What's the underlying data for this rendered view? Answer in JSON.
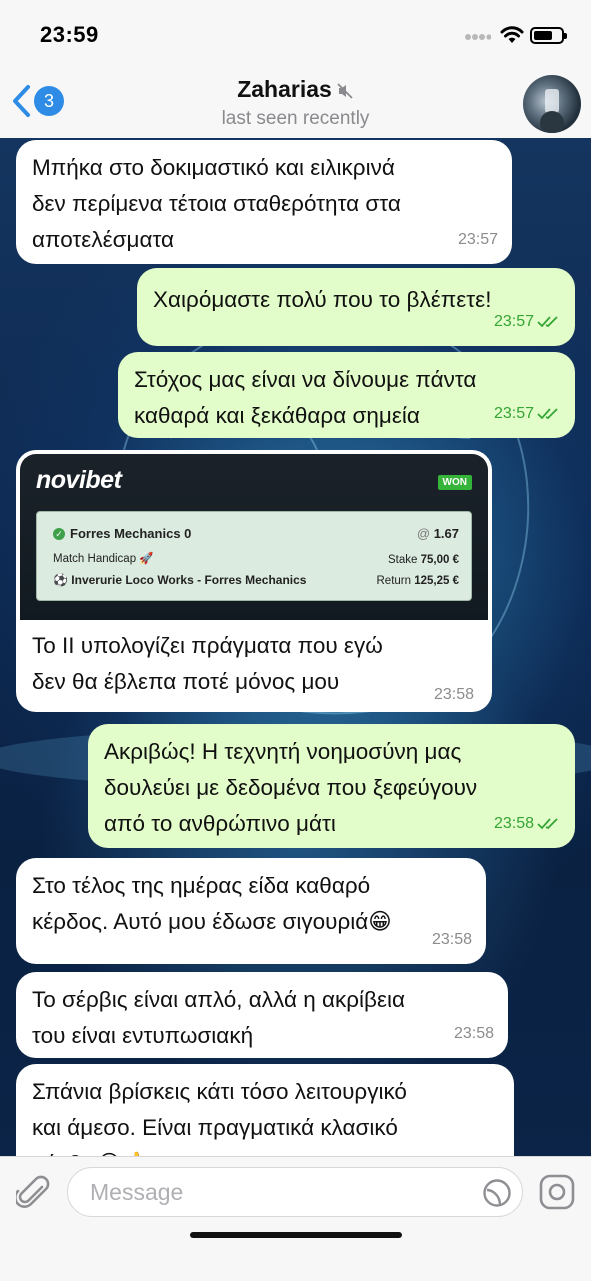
{
  "status": {
    "time": "23:59",
    "battery_level": 0.7
  },
  "header": {
    "back_count": "3",
    "contact_name": "Zaharias",
    "last_seen": "last seen recently"
  },
  "messages": [
    {
      "dir": "in",
      "text": "Μπήκα στο δοκιμαστικό και ειλικρινά\nδεν περίμενα τέτοια σταθερότητα στα\nαποτελέσματα",
      "time": "23:57"
    },
    {
      "dir": "out",
      "text": "Χαιρόμαστε πολύ που το βλέπετε!",
      "time": "23:57"
    },
    {
      "dir": "out",
      "text": "Στόχος μας είναι να δίνουμε πάντα\nκαθαρά και ξεκάθαρα σημεία",
      "time": "23:57"
    },
    {
      "dir": "in",
      "text": "Το ΙΙ υπολογίζει πράγματα που εγώ\nδεν θα έβλεπα ποτέ μόνος μου",
      "time": "23:58"
    },
    {
      "dir": "out",
      "text": "Ακριβώς! Η τεχνητή νοημοσύνη μας\nδουλεύει με δεδομένα που ξεφεύγουν\nαπό το ανθρώπινο μάτι",
      "time": "23:58"
    },
    {
      "dir": "in",
      "text": "Στο τέλος της ημέρας είδα καθαρό\nκέρδος. Αυτό μου έδωσε σιγουριά😁",
      "time": "23:58"
    },
    {
      "dir": "in",
      "text": "Το σέρβις είναι απλό, αλλά η ακρίβεια\nτου είναι εντυπωσιακή",
      "time": "23:58"
    },
    {
      "dir": "in",
      "text": "Σπάνια βρίσκεις κάτι τόσο λειτουργικό\nκαι άμεσο. Είναι πραγματικά κλασικό\nσέρβις😊👍",
      "time": ""
    }
  ],
  "bet_slip": {
    "brand": "novibet",
    "badge": "WON",
    "selection": "Forres Mechanics 0",
    "odds_prefix": "@",
    "odds": "1.67",
    "market": "Match Handicap 🚀",
    "stake_label": "Stake",
    "stake": "75,00 €",
    "event": "Inverurie Loco Works - Forres Mechanics",
    "return_label": "Return",
    "return": "125,25 €"
  },
  "input": {
    "placeholder": "Message"
  },
  "colors": {
    "incoming": "#ffffff",
    "outgoing": "#e2fdc9",
    "accent": "#2e8ce6",
    "check": "#35a535"
  }
}
